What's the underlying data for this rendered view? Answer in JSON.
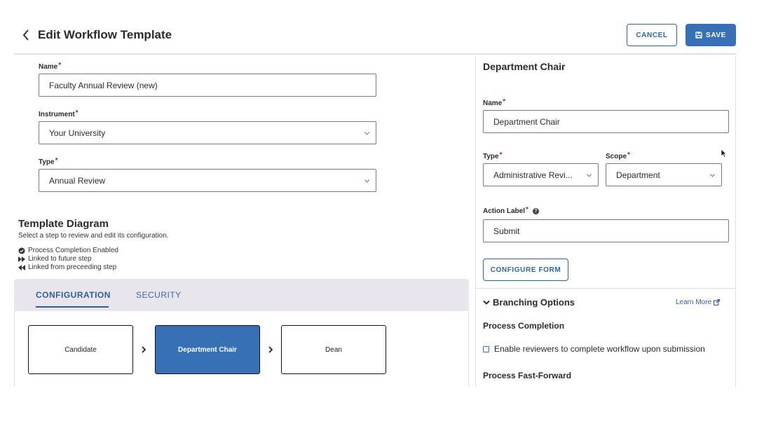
{
  "header": {
    "title": "Edit Workflow Template",
    "cancel_label": "CANCEL",
    "save_label": "SAVE"
  },
  "form": {
    "name": {
      "label": "Name",
      "value": "Faculty Annual Review (new)"
    },
    "instrument": {
      "label": "Instrument",
      "value": "Your University"
    },
    "type": {
      "label": "Type",
      "value": "Annual Review"
    }
  },
  "diagram": {
    "title": "Template Diagram",
    "subtitle": "Select a step to review and edit its configuration.",
    "legend": [
      {
        "icon": "check-circle-icon",
        "label": "Process Completion Enabled"
      },
      {
        "icon": "fast-forward-icon",
        "label": "Linked to future step"
      },
      {
        "icon": "rewind-icon",
        "label": "Linked from preceeding step"
      }
    ],
    "tabs": [
      {
        "label": "CONFIGURATION",
        "active": true
      },
      {
        "label": "SECURITY",
        "active": false
      }
    ],
    "steps": [
      {
        "label": "Candidate",
        "active": false
      },
      {
        "label": "Department Chair",
        "active": true
      },
      {
        "label": "Dean",
        "active": false
      }
    ]
  },
  "panel": {
    "title": "Department Chair",
    "name": {
      "label": "Name",
      "value": "Department Chair"
    },
    "type": {
      "label": "Type",
      "value": "Administrative Revi..."
    },
    "scope": {
      "label": "Scope",
      "value": "Department"
    },
    "action_label": {
      "label": "Action Label",
      "value": "Submit"
    },
    "configure_form_label": "CONFIGURE FORM",
    "branching": {
      "title": "Branching Options",
      "learn_more": "Learn More",
      "process_completion_heading": "Process Completion",
      "process_completion_checkbox": "Enable reviewers to complete workflow upon submission",
      "process_completion_checked": false,
      "fast_forward_heading": "Process Fast-Forward"
    }
  },
  "colors": {
    "primary": "#3770b5",
    "link": "#2d5fa0",
    "required": "#b71c1c",
    "tab_bar": "#e8e6ec"
  }
}
